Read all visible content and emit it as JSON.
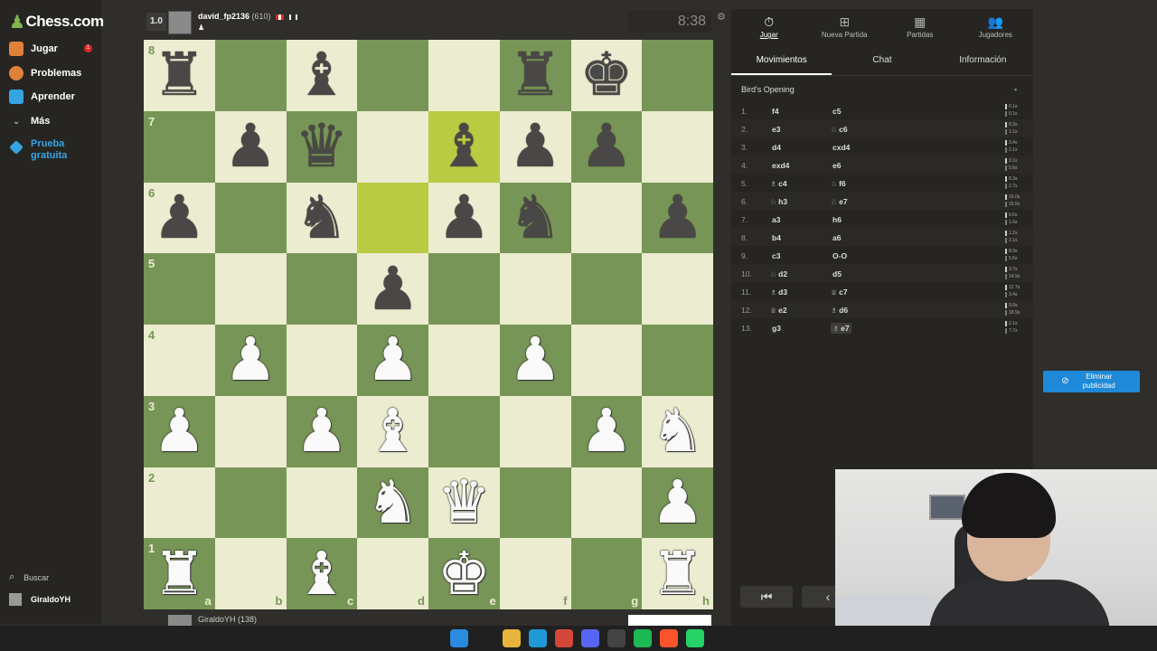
{
  "sidebar": {
    "logo": "Chess.com",
    "items": [
      {
        "label": "Jugar",
        "icon": "play-icon",
        "color": "#e0813a"
      },
      {
        "label": "Problemas",
        "icon": "puzzle-icon",
        "color": "#e0813a"
      },
      {
        "label": "Aprender",
        "icon": "learn-icon",
        "color": "#36a4e2"
      },
      {
        "label": "Más",
        "icon": "chevron-down-icon"
      },
      {
        "label": "Prueba gratuita",
        "icon": "diamond-icon",
        "color": "#36a4e2"
      }
    ],
    "badge": "1",
    "search_label": "Buscar",
    "user_label": "GiraldoYH"
  },
  "top_player": {
    "rating_box": "1.0",
    "name": "david_fp2136",
    "rating": "(610)",
    "clock": "8:38"
  },
  "bottom_player": {
    "name": "GiraldoYH (138)"
  },
  "board": {
    "light_color": "#ebecd0",
    "dark_color": "#779556",
    "highlight_light": "#f5f682",
    "highlight_dark": "#b9ca43",
    "highlighted_squares": [
      "e7",
      "d6"
    ],
    "ranks": [
      "8",
      "7",
      "6",
      "5",
      "4",
      "3",
      "2",
      "1"
    ],
    "files": [
      "a",
      "b",
      "c",
      "d",
      "e",
      "f",
      "g",
      "h"
    ],
    "position": [
      [
        "r",
        "",
        "b",
        "",
        "",
        "r",
        "k",
        ""
      ],
      [
        "",
        "p",
        "q",
        "",
        "b",
        "p",
        "p",
        ""
      ],
      [
        "p",
        "",
        "n",
        "",
        "p",
        "n",
        "",
        "p"
      ],
      [
        "",
        "",
        "",
        "p",
        "",
        "",
        "",
        ""
      ],
      [
        "",
        "P",
        "",
        "P",
        "",
        "P",
        "",
        ""
      ],
      [
        "P",
        "",
        "P",
        "B",
        "",
        "",
        "P",
        "N"
      ],
      [
        "",
        "",
        "",
        "N",
        "Q",
        "",
        "",
        "P"
      ],
      [
        "R",
        "",
        "B",
        "",
        "K",
        "",
        "",
        "R"
      ]
    ]
  },
  "panel": {
    "top_tabs": [
      {
        "label": "Jugar",
        "icon": "stopwatch-icon"
      },
      {
        "label": "Nueva Partida",
        "icon": "plus-square-icon"
      },
      {
        "label": "Partidas",
        "icon": "board-icon"
      },
      {
        "label": "Jugadores",
        "icon": "players-icon"
      }
    ],
    "sub_tabs": [
      "Movimientos",
      "Chat",
      "Información"
    ],
    "opening": "Bird's Opening",
    "moves": [
      {
        "no": "1.",
        "white": "f4",
        "white_fig": "",
        "black": "c5",
        "black_fig": "",
        "tw": "0.1s",
        "tb": "0.1s"
      },
      {
        "no": "2.",
        "white": "e3",
        "white_fig": "",
        "black": "c6",
        "black_fig": "♘",
        "tw": "6.3s",
        "tb": "1.1s"
      },
      {
        "no": "3.",
        "white": "d4",
        "white_fig": "",
        "black": "cxd4",
        "black_fig": "",
        "tw": "3.4s",
        "tb": "2.1s"
      },
      {
        "no": "4.",
        "white": "exd4",
        "white_fig": "",
        "black": "e6",
        "black_fig": "",
        "tw": "3.1s",
        "tb": "5.6s"
      },
      {
        "no": "5.",
        "white": "c4",
        "white_fig": "♗",
        "black": "f6",
        "black_fig": "♘",
        "tw": "8.3s",
        "tb": "2.7s"
      },
      {
        "no": "6.",
        "white": "h3",
        "white_fig": "♘",
        "black": "e7",
        "black_fig": "♘",
        "tw": "15.0s",
        "tb": "15.5s"
      },
      {
        "no": "7.",
        "white": "a3",
        "white_fig": "",
        "black": "h6",
        "black_fig": "",
        "tw": "6.6s",
        "tb": "1.6s"
      },
      {
        "no": "8.",
        "white": "b4",
        "white_fig": "",
        "black": "a6",
        "black_fig": "",
        "tw": "1.2s",
        "tb": "2.1s"
      },
      {
        "no": "9.",
        "white": "c3",
        "white_fig": "",
        "black": "O-O",
        "black_fig": "",
        "tw": "8.9s",
        "tb": "5.6s"
      },
      {
        "no": "10.",
        "white": "d2",
        "white_fig": "♘",
        "black": "d5",
        "black_fig": "",
        "tw": "3.7s",
        "tb": "14.9s"
      },
      {
        "no": "11.",
        "white": "d3",
        "white_fig": "♗",
        "black": "c7",
        "black_fig": "♕",
        "tw": "12.7s",
        "tb": "3.4s"
      },
      {
        "no": "12.",
        "white": "e2",
        "white_fig": "♕",
        "black": "d6",
        "black_fig": "♗",
        "tw": "0.0s",
        "tb": "18.9s"
      },
      {
        "no": "13.",
        "white": "g3",
        "white_fig": "",
        "black": "e7",
        "black_fig": "♗",
        "tw": "2.1s",
        "tb": "7.7s"
      }
    ],
    "nav": [
      "first-move-icon",
      "prev-move-icon"
    ]
  },
  "ad": {
    "label": "Eliminar publicidad"
  },
  "taskbar": {
    "icons": [
      {
        "name": "windows-start-icon",
        "color": "#2a8be0"
      },
      {
        "name": "search-icon",
        "color": "#202020"
      },
      {
        "name": "file-explorer-icon",
        "color": "#e8b43a"
      },
      {
        "name": "edge-icon",
        "color": "#1f9ad6"
      },
      {
        "name": "chrome-icon",
        "color": "#d4473a"
      },
      {
        "name": "discord-icon",
        "color": "#5865f2"
      },
      {
        "name": "obs-icon",
        "color": "#444444"
      },
      {
        "name": "spotify-icon",
        "color": "#1db954"
      },
      {
        "name": "brave-icon",
        "color": "#fb542b"
      },
      {
        "name": "whatsapp-icon",
        "color": "#25d366"
      }
    ]
  }
}
